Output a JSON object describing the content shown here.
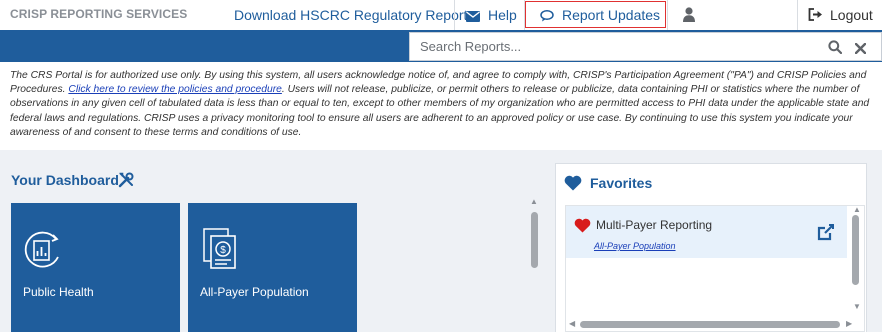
{
  "header": {
    "brand": "CRISP REPORTING SERVICES",
    "download_link": "Download HSCRC Regulatory Reports",
    "help_label": "Help",
    "updates_label": "Report Updates",
    "logout_label": "Logout"
  },
  "search": {
    "placeholder": "Search Reports..."
  },
  "disclaimer": {
    "text_before_link": "The CRS Portal is for authorized use only. By using this system, all users acknowledge notice of, and agree to comply with, CRISP's Participation Agreement (\"PA\") and CRISP Policies and Procedures. ",
    "link_text": "Click here to review the policies and procedure",
    "text_after_link": ". Users will not release, publicize, or permit others to release or publicize, data containing PHI or statistics where the number of observations in any given cell of tabulated data is less than or equal to ten, except to other members of my organization who are permitted access to PHI data under the applicable state and federal laws and regulations. CRISP uses a privacy monitoring tool to ensure all users are adherent to an approved policy or use case. By continuing to use this system you indicate your awareness of and consent to these terms and conditions of use."
  },
  "dashboard": {
    "title": "Your Dashboard",
    "tiles": [
      {
        "label": "Public Health",
        "icon": "public-health-icon"
      },
      {
        "label": "All-Payer Population",
        "icon": "all-payer-document-icon"
      }
    ]
  },
  "favorites": {
    "title": "Favorites",
    "items": [
      {
        "title": "Multi-Payer Reporting",
        "subtitle": "All-Payer Population"
      }
    ]
  },
  "colors": {
    "brand_blue": "#1f5d9c",
    "highlight_red": "#e03131",
    "favorite_heart": "#d81b1b"
  }
}
